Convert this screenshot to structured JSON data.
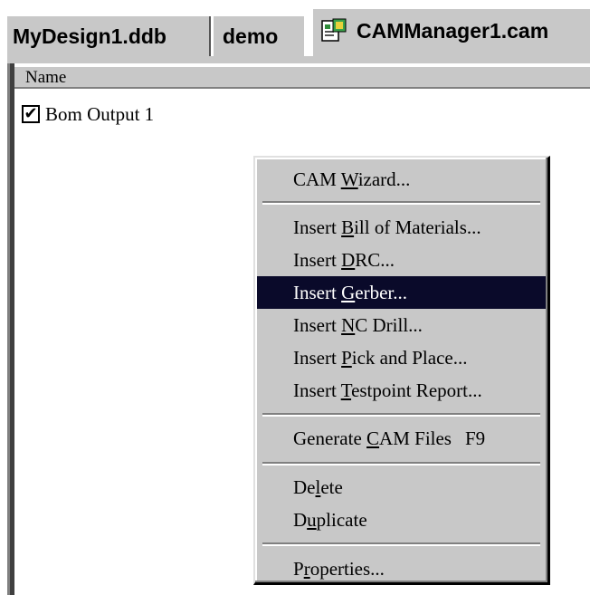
{
  "tabs": [
    {
      "label": "MyDesign1.ddb"
    },
    {
      "label": "demo"
    },
    {
      "label": "CAMManager1.cam",
      "icon": "cam-document-icon",
      "active": true
    }
  ],
  "list": {
    "column_header": "Name",
    "items": [
      {
        "label": "Bom Output 1",
        "checked": true
      }
    ]
  },
  "context_menu": {
    "items": [
      {
        "pre": "CAM ",
        "u": "W",
        "post": "izard..."
      },
      {
        "pre": "Insert ",
        "u": "B",
        "post": "ill of Materials..."
      },
      {
        "pre": "Insert ",
        "u": "D",
        "post": "RC..."
      },
      {
        "pre": "Insert ",
        "u": "G",
        "post": "erber...",
        "highlighted": true
      },
      {
        "pre": "Insert ",
        "u": "N",
        "post": "C Drill..."
      },
      {
        "pre": "Insert ",
        "u": "P",
        "post": "ick and Place..."
      },
      {
        "pre": "Insert ",
        "u": "T",
        "post": "estpoint Report..."
      },
      {
        "pre": "Generate ",
        "u": "C",
        "post": "AM Files",
        "shortcut": "F9"
      },
      {
        "pre": "De",
        "u": "l",
        "post": "ete"
      },
      {
        "pre": "D",
        "u": "u",
        "post": "plicate"
      },
      {
        "pre": "P",
        "u": "r",
        "post": "operties..."
      }
    ]
  },
  "colors": {
    "highlight": "#0a0a2a",
    "menu_bg": "#c8c8c8"
  }
}
